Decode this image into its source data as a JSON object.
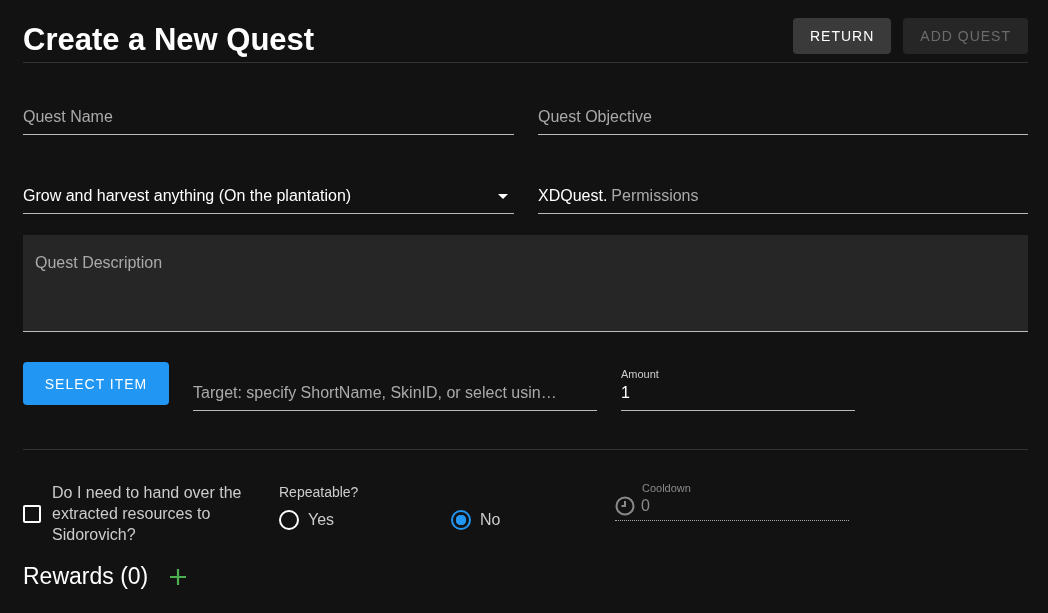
{
  "header": {
    "title": "Create a New Quest",
    "buttons": [
      {
        "label": "RETURN",
        "disabled": false
      },
      {
        "label": "ADD QUEST",
        "disabled": true
      }
    ]
  },
  "fields": {
    "quest_name": {
      "placeholder": "Quest Name"
    },
    "quest_objective": {
      "placeholder": "Quest Objective"
    },
    "quest_type": {
      "value": "Grow and harvest anything (On the plantation)"
    },
    "permission": {
      "prefix": "XDQuest.",
      "placeholder": "Permissions"
    },
    "description": {
      "placeholder": "Quest Description"
    }
  },
  "item": {
    "button": "SELECT ITEM",
    "target_placeholder": "Target: specify ShortName, SkinID, or select usin…",
    "amount_label": "Amount",
    "amount": "1"
  },
  "options": {
    "hand_over": {
      "label": "Do I need to hand over the extracted resources to Sidorovich?",
      "checked": false
    },
    "repeatable": {
      "label": "Repeatable?",
      "choices": [
        {
          "label": "Yes",
          "selected": false
        },
        {
          "label": "No",
          "selected": true
        }
      ]
    },
    "cooldown": {
      "label": "Cooldown",
      "value": "0",
      "disabled": true
    }
  },
  "rewards": {
    "title": "Rewards (0)"
  }
}
